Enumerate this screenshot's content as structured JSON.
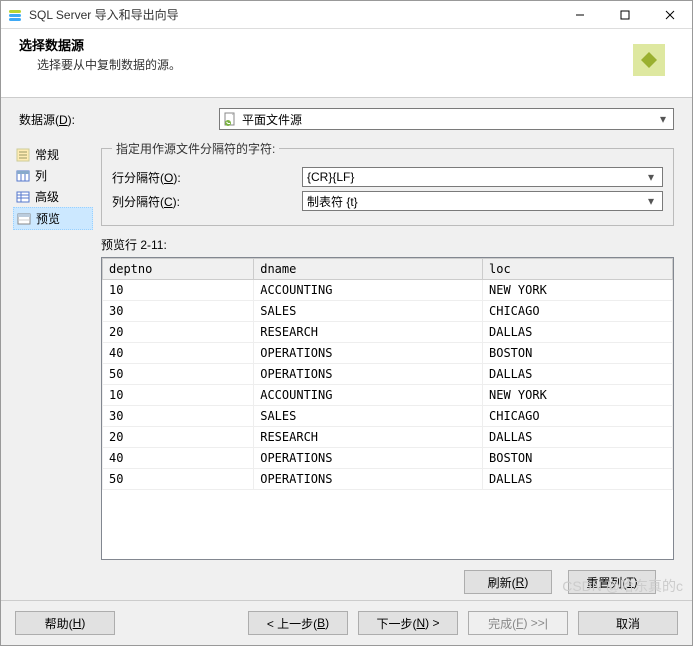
{
  "window": {
    "title": "SQL Server 导入和导出向导"
  },
  "header": {
    "title": "选择数据源",
    "subtitle": "选择要从中复制数据的源。"
  },
  "datasource": {
    "label_pre": "数据源(",
    "label_key": "D",
    "label_post": "):",
    "value": "平面文件源"
  },
  "sidebar": {
    "items": [
      {
        "label": "常规"
      },
      {
        "label": "列"
      },
      {
        "label": "高级"
      },
      {
        "label": "预览"
      }
    ]
  },
  "delimiter": {
    "legend": "指定用作源文件分隔符的字符:",
    "row_label_pre": "行分隔符(",
    "row_label_key": "O",
    "row_label_post": "):",
    "row_value": "{CR}{LF}",
    "col_label_pre": "列分隔符(",
    "col_label_key": "C",
    "col_label_post": "):",
    "col_value": "制表符 {t}"
  },
  "preview": {
    "label": "预览行 2-11:",
    "columns": [
      "deptno",
      "dname",
      "loc"
    ],
    "rows": [
      [
        "10",
        "ACCOUNTING",
        "NEW YORK"
      ],
      [
        "30",
        "SALES",
        "CHICAGO"
      ],
      [
        "20",
        "RESEARCH",
        "DALLAS"
      ],
      [
        "40",
        "OPERATIONS",
        "BOSTON"
      ],
      [
        "50",
        "OPERATIONS",
        "DALLAS"
      ],
      [
        "10",
        "ACCOUNTING",
        "NEW YORK"
      ],
      [
        "30",
        "SALES",
        "CHICAGO"
      ],
      [
        "20",
        "RESEARCH",
        "DALLAS"
      ],
      [
        "40",
        "OPERATIONS",
        "BOSTON"
      ],
      [
        "50",
        "OPERATIONS",
        "DALLAS"
      ]
    ]
  },
  "buttons": {
    "refresh_pre": "刷新(",
    "refresh_key": "R",
    "refresh_post": ")",
    "reset_pre": "重置列(",
    "reset_key": "T",
    "reset_post": ")",
    "help_pre": "帮助(",
    "help_key": "H",
    "help_post": ")",
    "back_pre": "< 上一步(",
    "back_key": "B",
    "back_post": ")",
    "next_pre": "下一步(",
    "next_key": "N",
    "next_post": ") >",
    "finish_pre": "完成(",
    "finish_key": "F",
    "finish_post": ") >>|",
    "cancel": "取消"
  },
  "watermark": "CSDN @哈东真的c"
}
